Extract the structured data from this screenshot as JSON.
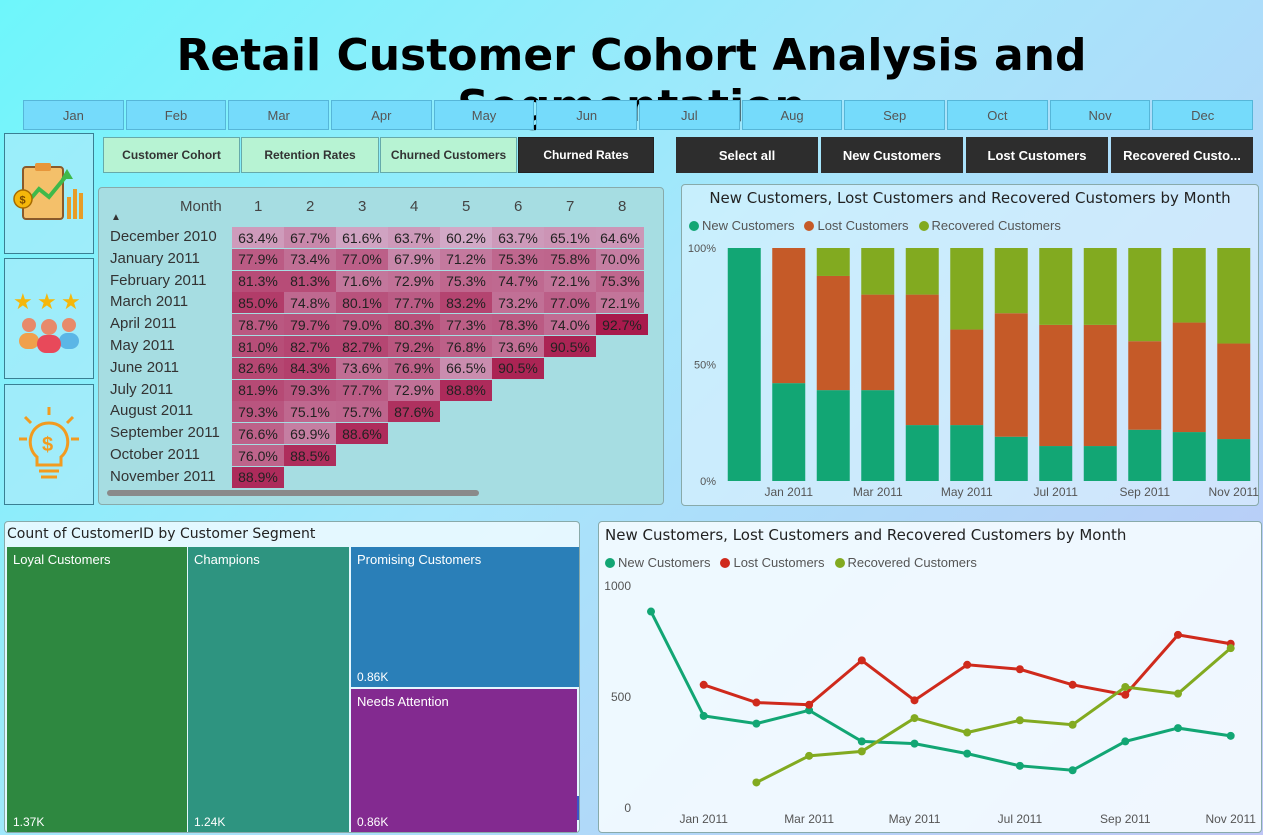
{
  "title": "Retail Customer Cohort Analysis and Segmentation",
  "months": [
    "Jan",
    "Feb",
    "Mar",
    "Apr",
    "May",
    "Jun",
    "Jul",
    "Aug",
    "Sep",
    "Oct",
    "Nov",
    "Dec"
  ],
  "side_icons": [
    "report-chart-icon",
    "customer-rating-icon",
    "idea-dollar-icon"
  ],
  "tabs": [
    "Customer Cohort",
    "Retention Rates",
    "Churned Customers",
    "Churned Rates"
  ],
  "segment_buttons": [
    "Select all",
    "New Customers",
    "Lost Customers",
    "Recovered Custo..."
  ],
  "cohort": {
    "month_header": "Month",
    "columns": [
      "1",
      "2",
      "3",
      "4",
      "5",
      "6",
      "7",
      "8"
    ],
    "rows": [
      {
        "label": "December 2010",
        "values": [
          "63.4%",
          "67.7%",
          "61.6%",
          "63.7%",
          "60.2%",
          "63.7%",
          "65.1%",
          "64.6%"
        ]
      },
      {
        "label": "January 2011",
        "values": [
          "77.9%",
          "73.4%",
          "77.0%",
          "67.9%",
          "71.2%",
          "75.3%",
          "75.8%",
          "70.0%"
        ]
      },
      {
        "label": "February 2011",
        "values": [
          "81.3%",
          "81.3%",
          "71.6%",
          "72.9%",
          "75.3%",
          "74.7%",
          "72.1%",
          "75.3%"
        ]
      },
      {
        "label": "March 2011",
        "values": [
          "85.0%",
          "74.8%",
          "80.1%",
          "77.7%",
          "83.2%",
          "73.2%",
          "77.0%",
          "72.1%"
        ]
      },
      {
        "label": "April 2011",
        "values": [
          "78.7%",
          "79.7%",
          "79.0%",
          "80.3%",
          "77.3%",
          "78.3%",
          "74.0%",
          "92.7%"
        ]
      },
      {
        "label": "May 2011",
        "values": [
          "81.0%",
          "82.7%",
          "82.7%",
          "79.2%",
          "76.8%",
          "73.6%",
          "90.5%"
        ]
      },
      {
        "label": "June 2011",
        "values": [
          "82.6%",
          "84.3%",
          "73.6%",
          "76.9%",
          "66.5%",
          "90.5%"
        ]
      },
      {
        "label": "July 2011",
        "values": [
          "81.9%",
          "79.3%",
          "77.7%",
          "72.9%",
          "88.8%"
        ]
      },
      {
        "label": "August 2011",
        "values": [
          "79.3%",
          "75.1%",
          "75.7%",
          "87.6%"
        ]
      },
      {
        "label": "September 2011",
        "values": [
          "76.6%",
          "69.9%",
          "88.6%"
        ]
      },
      {
        "label": "October 2011",
        "values": [
          "76.0%",
          "88.5%"
        ]
      },
      {
        "label": "November 2011",
        "values": [
          "88.9%"
        ]
      }
    ]
  },
  "bar_chart": {
    "title": "New Customers, Lost Customers and Recovered Customers by Month",
    "legend": [
      "New Customers",
      "Lost Customers",
      "Recovered Customers"
    ],
    "colors": [
      "#12a674",
      "#c55a28",
      "#82aa20"
    ],
    "y_ticks": [
      "0%",
      "50%",
      "100%"
    ],
    "x_labels": [
      "Jan 2011",
      "Mar 2011",
      "May 2011",
      "Jul 2011",
      "Sep 2011",
      "Nov 2011"
    ]
  },
  "line_chart": {
    "title": "New Customers, Lost Customers and Recovered Customers by Month",
    "legend": [
      "New Customers",
      "Lost Customers",
      "Recovered Customers"
    ],
    "colors": [
      "#12a674",
      "#cf2a1c",
      "#82aa20"
    ],
    "y_ticks": [
      "0",
      "500",
      "1000"
    ],
    "x_labels": [
      "Jan 2011",
      "Mar 2011",
      "May 2011",
      "Jul 2011",
      "Sep 2011",
      "Nov 2011"
    ]
  },
  "treemap": {
    "title": "Count of CustomerID by Customer Segment",
    "tiles": [
      {
        "label": "Loyal Customers",
        "value": "1.37K",
        "color": "#2e8840"
      },
      {
        "label": "Champions",
        "value": "1.24K",
        "color": "#2e9480"
      },
      {
        "label": "Promising Customers",
        "value": "0.86K",
        "color": "#2a7fb8"
      },
      {
        "label": "Needs Attention",
        "value": "0.86K",
        "color": "#832a90"
      }
    ]
  },
  "chart_data": [
    {
      "type": "bar",
      "stacked": "100%",
      "title": "New Customers, Lost Customers and Recovered Customers by Month",
      "categories": [
        "Dec 2010",
        "Jan 2011",
        "Feb 2011",
        "Mar 2011",
        "Apr 2011",
        "May 2011",
        "Jun 2011",
        "Jul 2011",
        "Aug 2011",
        "Sep 2011",
        "Oct 2011",
        "Nov 2011"
      ],
      "series": [
        {
          "name": "New Customers",
          "values": [
            100,
            42,
            39,
            39,
            24,
            24,
            19,
            15,
            15,
            22,
            21,
            18
          ]
        },
        {
          "name": "Lost Customers",
          "values": [
            0,
            58,
            49,
            41,
            56,
            41,
            53,
            52,
            52,
            38,
            47,
            41
          ]
        },
        {
          "name": "Recovered Customers",
          "values": [
            0,
            0,
            12,
            20,
            20,
            35,
            28,
            33,
            33,
            40,
            32,
            41
          ]
        }
      ],
      "ylim": [
        0,
        100
      ],
      "legend": "top-left"
    },
    {
      "type": "line",
      "title": "New Customers, Lost Customers and Recovered Customers by Month",
      "categories": [
        "Dec 2010",
        "Jan 2011",
        "Feb 2011",
        "Mar 2011",
        "Apr 2011",
        "May 2011",
        "Jun 2011",
        "Jul 2011",
        "Aug 2011",
        "Sep 2011",
        "Oct 2011",
        "Nov 2011"
      ],
      "series": [
        {
          "name": "New Customers",
          "values": [
            885,
            415,
            380,
            440,
            300,
            290,
            245,
            190,
            170,
            300,
            360,
            325
          ]
        },
        {
          "name": "Lost Customers",
          "values": [
            null,
            555,
            475,
            465,
            665,
            485,
            645,
            625,
            555,
            510,
            780,
            740
          ]
        },
        {
          "name": "Recovered Customers",
          "values": [
            null,
            null,
            115,
            235,
            255,
            405,
            340,
            395,
            375,
            545,
            515,
            720
          ]
        }
      ],
      "ylim": [
        0,
        1000
      ],
      "legend": "top-left"
    },
    {
      "type": "treemap",
      "title": "Count of CustomerID by Customer Segment",
      "categories": [
        "Loyal Customers",
        "Champions",
        "Promising Customers",
        "Needs Attention"
      ],
      "values": [
        1370,
        1240,
        860,
        860
      ]
    }
  ]
}
